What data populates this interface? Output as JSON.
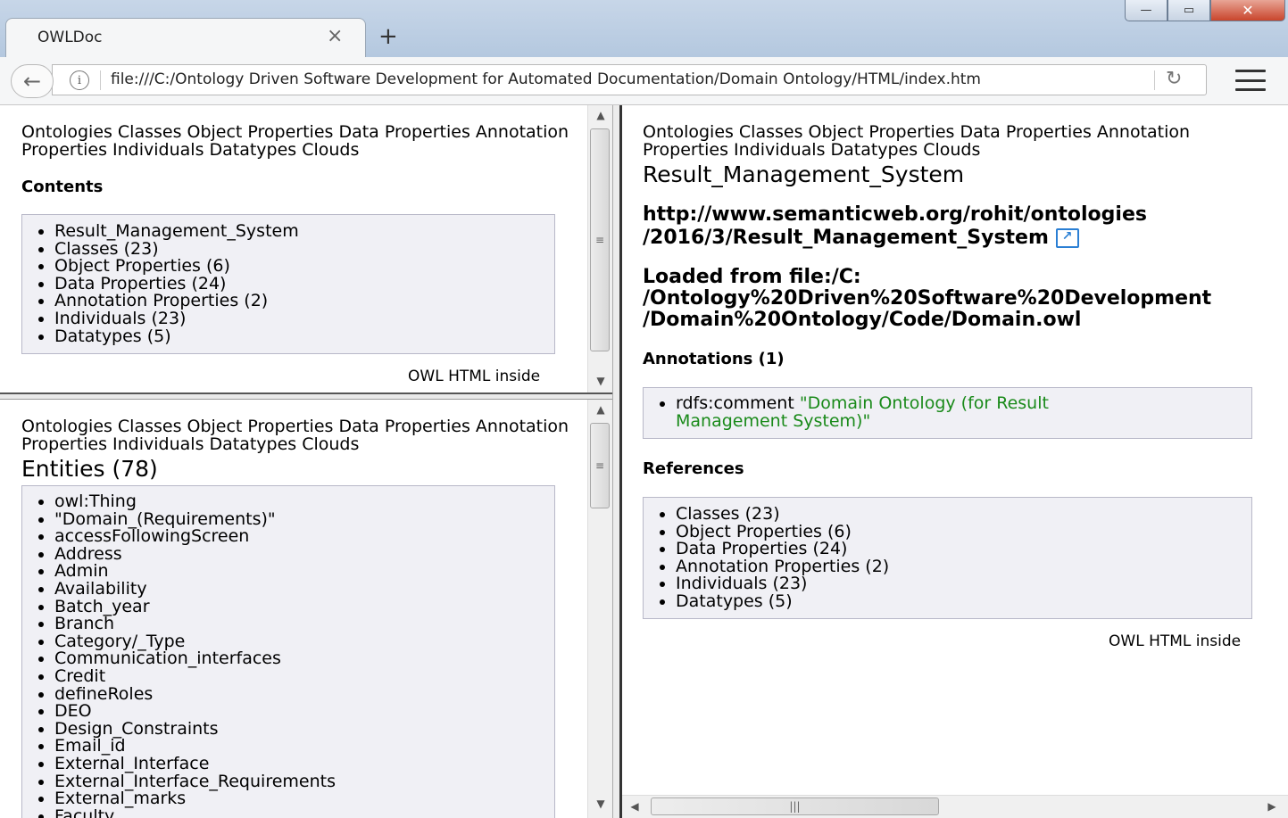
{
  "browser": {
    "tab_title": "OWLDoc",
    "tab_close": "×",
    "new_tab": "+",
    "url": "file:///C:/Ontology Driven Software Development for Automated Documentation/Domain Ontology/HTML/index.htm",
    "window": {
      "minimize": "—",
      "maximize": "▭",
      "close": "✕"
    }
  },
  "nav_links": [
    "Ontologies",
    "Classes",
    "Object Properties",
    "Data Properties",
    "Annotation Properties",
    "Individuals",
    "Datatypes",
    "Clouds"
  ],
  "contents_frame": {
    "heading": "Contents",
    "items": [
      "Result_Management_System",
      "Classes (23)",
      "Object Properties (6)",
      "Data Properties (24)",
      "Annotation Properties (2)",
      "Individuals (23)",
      "Datatypes (5)"
    ],
    "footer": "OWL HTML inside"
  },
  "entities_frame": {
    "title": "Entities (78)",
    "items": [
      "owl:Thing",
      "\"Domain_(Requirements)\"",
      "accessFollowingScreen",
      "Address",
      "Admin",
      "Availability",
      "Batch_year",
      "Branch",
      "Category/_Type",
      "Communication_interfaces",
      "Credit",
      "defineRoles",
      "DEO",
      "Design_Constraints",
      "Email_id",
      "External_Interface",
      "External_Interface_Requirements",
      "External_marks",
      "Faculty"
    ]
  },
  "main_frame": {
    "title": "Result_Management_System",
    "iri_line1": "http://www.semanticweb.org/rohit/ontologies",
    "iri_line2": "/2016/3/Result_Management_System",
    "loaded_line1": "Loaded from file:/C:",
    "loaded_line2": "/Ontology%20Driven%20Software%20Development",
    "loaded_line3": "/Domain%20Ontology/Code/Domain.owl",
    "annotations_heading": "Annotations (1)",
    "annotation_property": "rdfs:comment",
    "annotation_value_line1": "\"Domain Ontology (for Result",
    "annotation_value_line2": "Management System)\"",
    "references_heading": "References",
    "references": [
      "Classes (23)",
      "Object Properties (6)",
      "Data Properties (24)",
      "Annotation Properties (2)",
      "Individuals (23)",
      "Datatypes (5)"
    ],
    "footer": "OWL HTML inside"
  },
  "icons": {
    "back": "back-arrow-icon",
    "info": "info-icon",
    "reload": "reload-icon",
    "menu": "hamburger-menu-icon",
    "external": "external-link-icon"
  }
}
